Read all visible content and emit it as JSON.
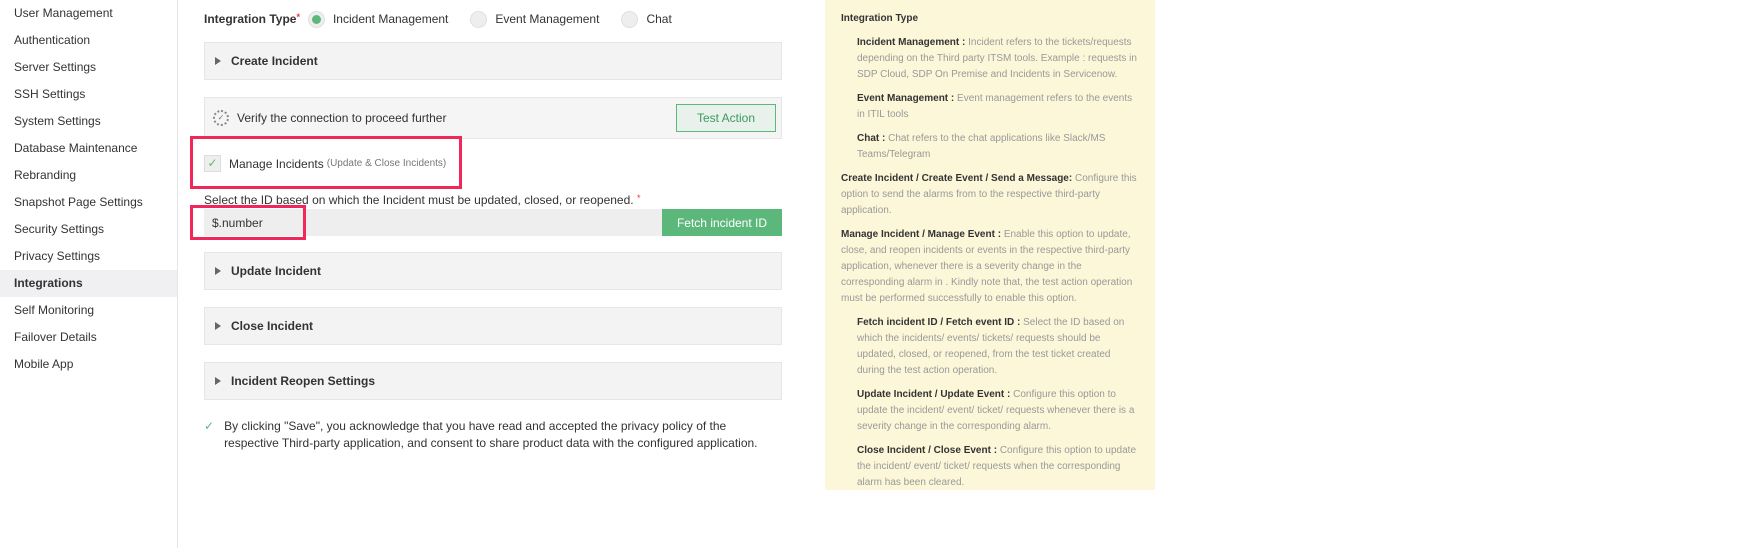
{
  "sidebar": {
    "items": [
      "User Management",
      "Authentication",
      "Server Settings",
      "SSH Settings",
      "System Settings",
      "Database Maintenance",
      "Rebranding",
      "Snapshot Page Settings",
      "Security Settings",
      "Privacy Settings",
      "Integrations",
      "Self Monitoring",
      "Failover Details",
      "Mobile App"
    ],
    "active": "Integrations"
  },
  "form": {
    "integration_type_label": "Integration Type",
    "required_mark": "*",
    "options": [
      "Incident Management",
      "Event Management",
      "Chat"
    ],
    "create_incident": "Create Incident",
    "verify_text": "Verify the connection to proceed further",
    "test_action": "Test Action",
    "manage_incidents": "Manage Incidents",
    "manage_sub": "(Update & Close Incidents)",
    "select_id_label": "Select the ID based on which the Incident must be updated, closed, or reopened.",
    "id_value": "$.number",
    "fetch_button": "Fetch incident ID",
    "update_incident": "Update Incident",
    "close_incident": "Close Incident",
    "reopen_settings": "Incident Reopen Settings",
    "consent": "By clicking \"Save\", you acknowledge that you have read and accepted the privacy policy of the respective Third-party application, and consent to share product data with the configured application."
  },
  "help": {
    "title": "Integration Type",
    "items": [
      {
        "term": "Incident Management :",
        "desc": "Incident refers to the tickets/requests depending on the Third party ITSM tools. Example : requests in SDP Cloud, SDP On Premise and Incidents in Servicenow.",
        "indent": true
      },
      {
        "term": "Event Management :",
        "desc": "Event management refers to the events in ITIL tools",
        "indent": true
      },
      {
        "term": "Chat :",
        "desc": "Chat refers to the chat applications like Slack/MS Teams/Telegram",
        "indent": true
      },
      {
        "term": "Create Incident / Create Event / Send a Message:",
        "desc": "Configure this option to send the alarms from  to the respective third-party application.",
        "indent": false
      },
      {
        "term": "Manage Incident / Manage Event :",
        "desc": "Enable this option to update, close, and reopen incidents or events in the respective third-party application, whenever there is a severity change in the corresponding alarm in . Kindly note that, the test action operation must be performed successfully to enable this option.",
        "indent": false
      },
      {
        "term": "Fetch incident ID / Fetch event ID :",
        "desc": "Select the ID based on which the incidents/ events/ tickets/ requests should be updated, closed, or reopened, from the test ticket created during the test action operation.",
        "indent": true
      },
      {
        "term": "Update Incident / Update Event :",
        "desc": "Configure this option to update the incident/ event/ ticket/ requests whenever there is a severity change in the corresponding alarm.",
        "indent": true
      },
      {
        "term": "Close Incident / Close Event :",
        "desc": "Configure this option to update the incident/ event/ ticket/ requests when the corresponding alarm has been cleared.",
        "indent": true
      }
    ]
  }
}
